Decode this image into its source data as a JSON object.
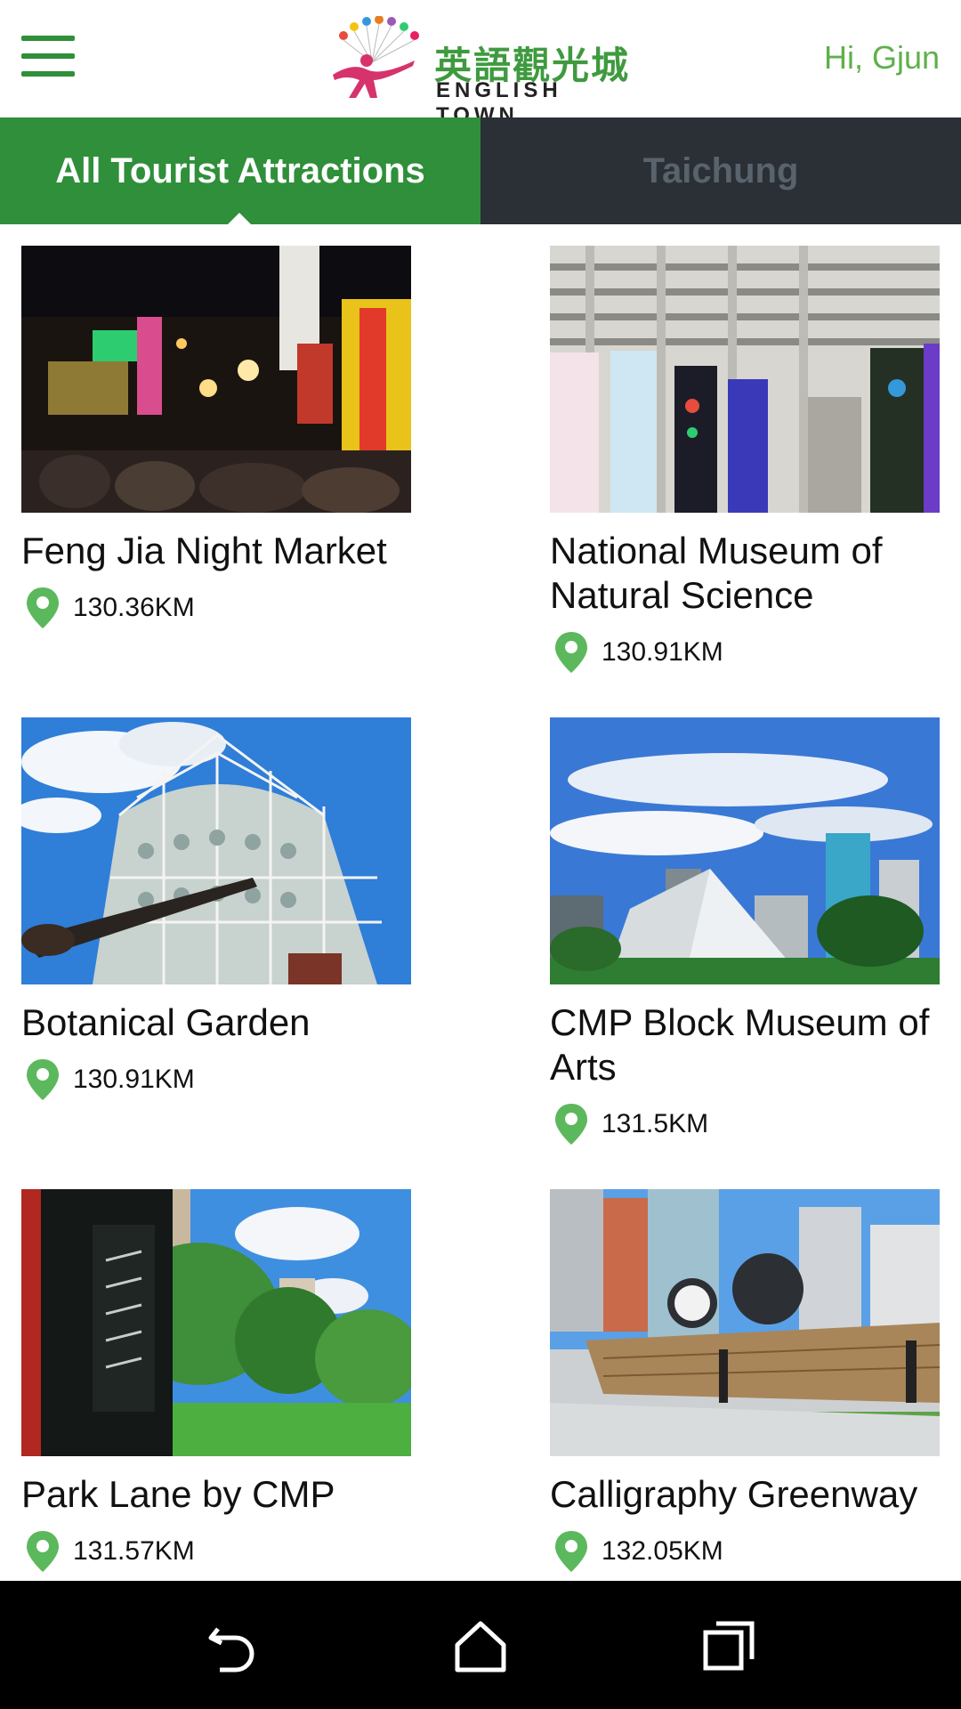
{
  "header": {
    "logo_cn": "英語觀光城",
    "logo_en": "ENGLISH TOWN",
    "greeting": "Hi, Gjun"
  },
  "tabs": [
    {
      "label": "All Tourist Attractions",
      "active": true
    },
    {
      "label": "Taichung",
      "active": false
    }
  ],
  "attractions": [
    {
      "name": "Feng Jia Night Market",
      "distance": "130.36KM"
    },
    {
      "name": "National Museum of Natural Science",
      "distance": "130.91KM"
    },
    {
      "name": "Botanical Garden",
      "distance": "130.91KM"
    },
    {
      "name": "CMP Block Museum of Arts",
      "distance": "131.5KM"
    },
    {
      "name": "Park Lane by CMP",
      "distance": "131.57KM"
    },
    {
      "name": "Calligraphy Greenway",
      "distance": "132.05KM"
    }
  ],
  "colors": {
    "brand_green": "#2f8f3a",
    "greeting_green": "#5fb04a",
    "tab_inactive_bg": "#2a3035",
    "pin_green": "#5cb85c"
  },
  "navbar": {
    "icons": [
      "back-icon",
      "home-icon",
      "recents-icon"
    ]
  }
}
